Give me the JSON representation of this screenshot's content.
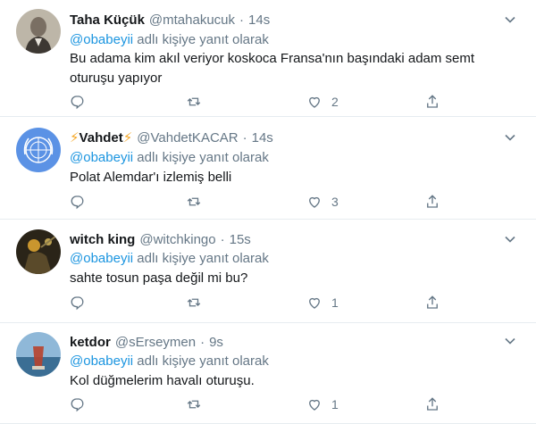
{
  "reply_prefix": "adlı kişiye yanıt olarak",
  "tweets": [
    {
      "name": "Taha Küçük",
      "handle": "@mtahakucuk",
      "separator": "·",
      "time": "14s",
      "mention": "@obabeyii",
      "text": "Bu adama kim akıl veriyor koskoca Fransa'nın başındaki adam semt oturuşu yapıyor",
      "likes": "2",
      "avatar": "portrait-photo"
    },
    {
      "name": "Vahdet",
      "name_emoji": "⚡",
      "handle": "@VahdetKACAR",
      "separator": "·",
      "time": "14s",
      "mention": "@obabeyii",
      "text": "Polat Alemdar'ı izlemiş belli",
      "likes": "3",
      "avatar": "un-emblem"
    },
    {
      "name": "witch king",
      "handle": "@witchkingo",
      "separator": "·",
      "time": "15s",
      "mention": "@obabeyii",
      "text": "sahte tosun paşa değil mi bu?",
      "likes": "1",
      "avatar": "dark-character"
    },
    {
      "name": "ketdor",
      "handle": "@sErseymen",
      "separator": "·",
      "time": "9s",
      "mention": "@obabeyii",
      "text": "Kol düğmelerim havalı oturuşu.",
      "likes": "1",
      "avatar": "tea-glass-sea"
    }
  ],
  "icons": {
    "reply": "reply-icon",
    "retweet": "retweet-icon",
    "like": "heart-icon",
    "share": "share-icon",
    "more": "chevron-down-icon"
  },
  "colors": {
    "text": "#14171a",
    "secondary": "#657786",
    "mention": "#1b95e0",
    "border": "#e6ecf0"
  }
}
